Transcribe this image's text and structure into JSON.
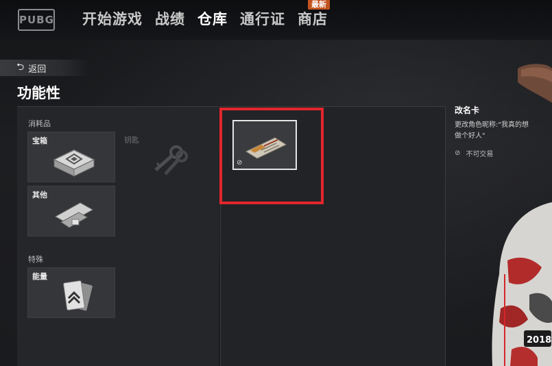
{
  "header": {
    "logo": "PUBG",
    "nav": [
      "开始游戏",
      "战绩",
      "仓库",
      "通行证",
      "商店"
    ],
    "active_index": 2,
    "new_badge": "最新"
  },
  "back_label": "返回",
  "page_title": "功能性",
  "categories": {
    "consumables_label": "消耗品",
    "special_label": "特殊",
    "tiles": {
      "crate": "宝箱",
      "key": "钥匙",
      "other": "其他",
      "energy": "能量"
    }
  },
  "detail": {
    "name": "改名卡",
    "description": "更改角色昵称:\"我真的想做个好人\"",
    "trade_status": "不可交易"
  },
  "icons": {
    "back": "back-arrow-icon",
    "no_trade": "no-entry-icon",
    "highlight_color": "#e3262c"
  }
}
